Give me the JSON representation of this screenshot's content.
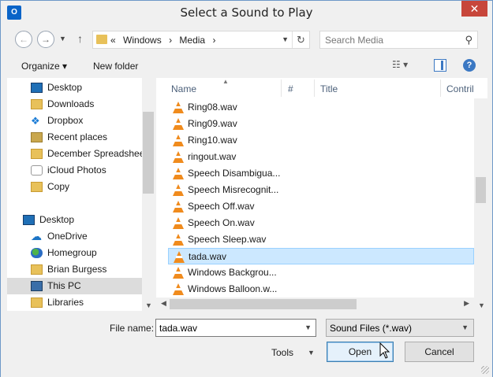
{
  "window": {
    "title": "Select a Sound to Play",
    "app_icon": "O",
    "close": "✕"
  },
  "nav": {
    "back_icon": "←",
    "forward_icon": "→",
    "up_icon": "↑",
    "path": [
      "«",
      "Windows",
      "›",
      "Media",
      "›"
    ],
    "refresh_icon": "↻",
    "search_placeholder": "Search Media",
    "search_icon": "⚲"
  },
  "toolbar": {
    "organize": "Organize ▾",
    "new_folder": "New folder",
    "views": "☷ ▾",
    "help": "?"
  },
  "sidebar": {
    "items": [
      {
        "label": "Desktop",
        "icon": "desktop-icon",
        "top": 0
      },
      {
        "label": "Downloads",
        "icon": "folder-icon"
      },
      {
        "label": "Dropbox",
        "icon": "dropbox-icon"
      },
      {
        "label": "Recent places",
        "icon": "recent-places-icon"
      },
      {
        "label": "December Spreadsheets",
        "icon": "folder-icon"
      },
      {
        "label": "iCloud Photos",
        "icon": "icloud-photos-icon"
      },
      {
        "label": "Copy",
        "icon": "copy-folder-icon"
      },
      {
        "label": "Desktop",
        "icon": "desktop-icon"
      },
      {
        "label": "OneDrive",
        "icon": "cloud-icon"
      },
      {
        "label": "Homegroup",
        "icon": "homegroup-icon"
      },
      {
        "label": "Brian Burgess",
        "icon": "user-folder-icon"
      },
      {
        "label": "This PC",
        "icon": "pc-icon"
      },
      {
        "label": "Libraries",
        "icon": "libraries-icon"
      }
    ]
  },
  "file_list": {
    "columns": [
      "Name",
      "#",
      "Title",
      "Contril"
    ],
    "files": [
      "Ring08.wav",
      "Ring09.wav",
      "Ring10.wav",
      "ringout.wav",
      "Speech Disambigua...",
      "Speech Misrecognit...",
      "Speech Off.wav",
      "Speech On.wav",
      "Speech Sleep.wav",
      "tada.wav",
      "Windows Backgrou...",
      "Windows Balloon.w..."
    ],
    "selected_file": "tada.wav"
  },
  "bottom": {
    "file_name_label": "File name:",
    "file_name_value": "tada.wav",
    "file_type": "Sound Files (*.wav)",
    "tools": "Tools",
    "open": "Open",
    "cancel": "Cancel"
  }
}
